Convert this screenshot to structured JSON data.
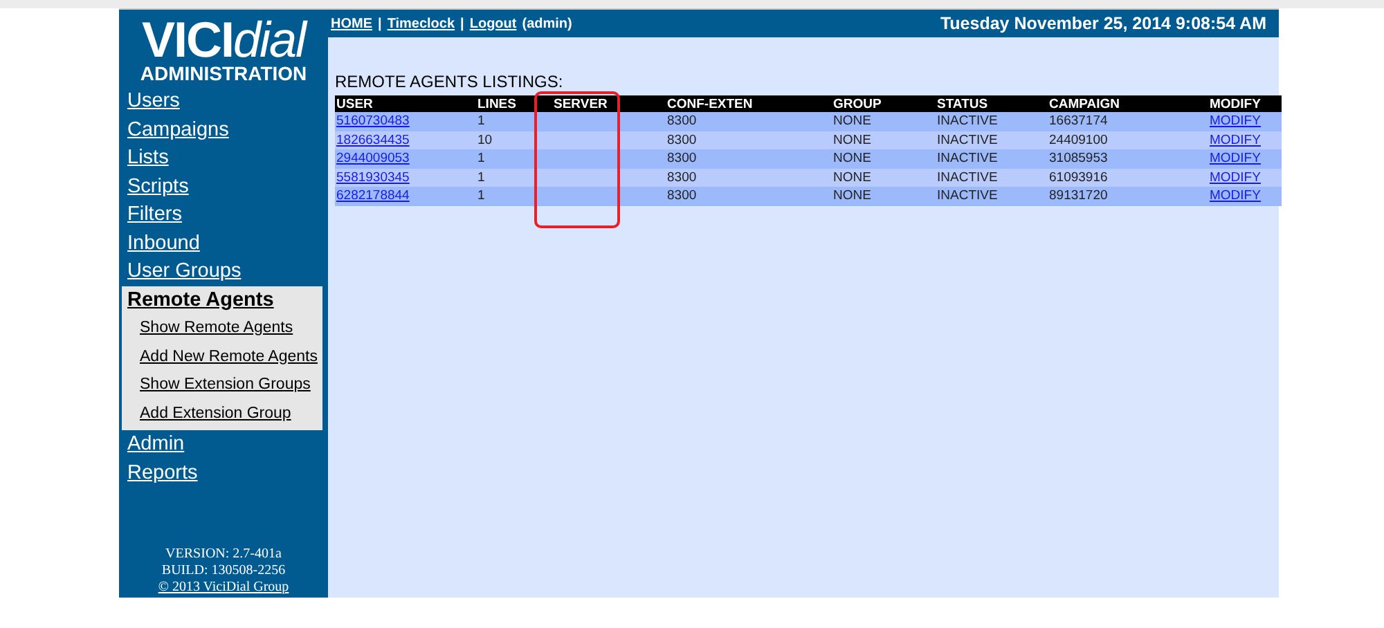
{
  "logo": {
    "strong": "VICI",
    "light": "dial",
    "subtitle": "ADMINISTRATION"
  },
  "sidebar": {
    "items": [
      {
        "label": "Users",
        "selected": false
      },
      {
        "label": "Campaigns",
        "selected": false
      },
      {
        "label": "Lists",
        "selected": false
      },
      {
        "label": "Scripts",
        "selected": false
      },
      {
        "label": "Filters",
        "selected": false
      },
      {
        "label": "Inbound",
        "selected": false
      },
      {
        "label": "User Groups",
        "selected": false
      },
      {
        "label": "Remote Agents",
        "selected": true,
        "children": [
          "Show Remote Agents",
          "Add New Remote Agents",
          "Show Extension Groups",
          "Add Extension Group"
        ]
      },
      {
        "label": "Admin",
        "selected": false
      },
      {
        "label": "Reports",
        "selected": false
      }
    ],
    "version": "VERSION: 2.7-401a",
    "build": "BUILD: 130508-2256",
    "copyright": "© 2013 ViciDial Group"
  },
  "top_bar": {
    "links": [
      "HOME",
      "Timeclock",
      "Logout"
    ],
    "separator": "|",
    "user": "(admin)",
    "datetime": "Tuesday November 25, 2014 9:08:54 AM"
  },
  "table": {
    "title": "REMOTE AGENTS LISTINGS:",
    "columns": [
      "USER",
      "LINES",
      "SERVER",
      "CONF-EXTEN",
      "GROUP",
      "STATUS",
      "CAMPAIGN",
      "MODIFY"
    ],
    "rows": [
      [
        "5160730483",
        "1",
        "",
        "8300",
        "NONE",
        "INACTIVE",
        "16637174",
        "MODIFY"
      ],
      [
        "1826634435",
        "10",
        "",
        "8300",
        "NONE",
        "INACTIVE",
        "24409100",
        "MODIFY"
      ],
      [
        "2944009053",
        "1",
        "",
        "8300",
        "NONE",
        "INACTIVE",
        "31085953",
        "MODIFY"
      ],
      [
        "5581930345",
        "1",
        "",
        "8300",
        "NONE",
        "INACTIVE",
        "61093916",
        "MODIFY"
      ],
      [
        "6282178844",
        "1",
        "",
        "8300",
        "NONE",
        "INACTIVE",
        "89131720",
        "MODIFY"
      ]
    ]
  }
}
